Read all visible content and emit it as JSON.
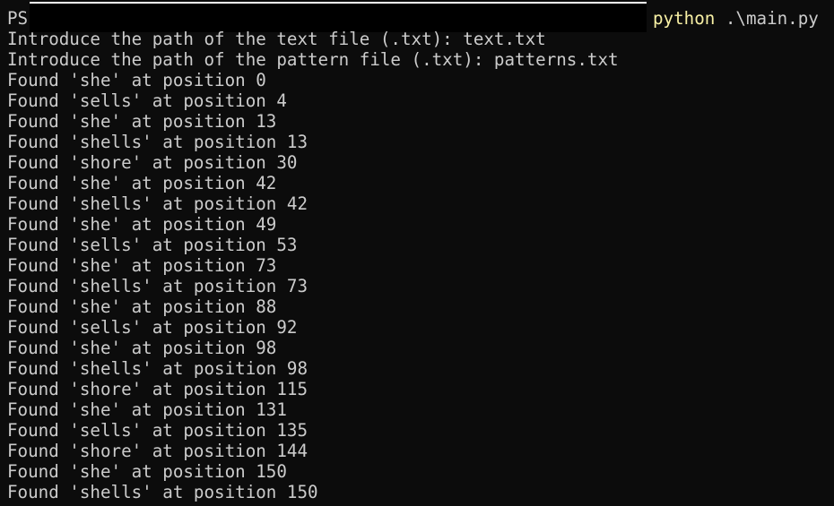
{
  "prompt": {
    "ps_label": "PS",
    "command_name": "python",
    "command_arg": " .\\main.py"
  },
  "output_lines": [
    "Introduce the path of the text file (.txt): text.txt",
    "Introduce the path of the pattern file (.txt): patterns.txt",
    "Found 'she' at position 0",
    "Found 'sells' at position 4",
    "Found 'she' at position 13",
    "Found 'shells' at position 13",
    "Found 'shore' at position 30",
    "Found 'she' at position 42",
    "Found 'shells' at position 42",
    "Found 'she' at position 49",
    "Found 'sells' at position 53",
    "Found 'she' at position 73",
    "Found 'shells' at position 73",
    "Found 'she' at position 88",
    "Found 'sells' at position 92",
    "Found 'she' at position 98",
    "Found 'shells' at position 98",
    "Found 'shore' at position 115",
    "Found 'she' at position 131",
    "Found 'sells' at position 135",
    "Found 'shore' at position 144",
    "Found 'she' at position 150",
    "Found 'shells' at position 150"
  ],
  "colors": {
    "background": "#0c0c0c",
    "foreground": "#cccccc",
    "command_highlight": "#f9f1a5",
    "redaction": "#000000"
  }
}
